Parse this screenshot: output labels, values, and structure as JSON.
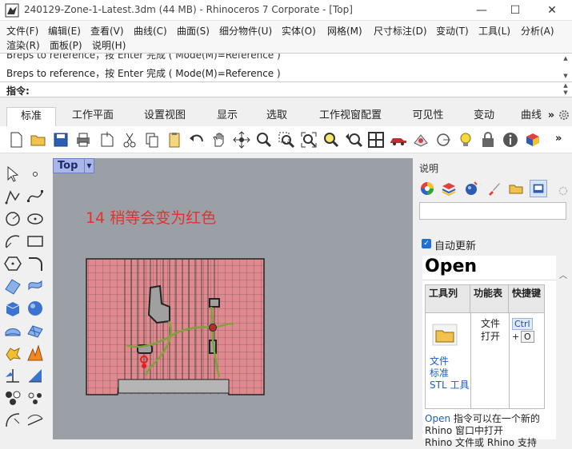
{
  "window": {
    "title": "240129-Zone-1-Latest.3dm (44 MB) - Rhinoceros 7 Corporate - [Top]",
    "minimize": "—",
    "maximize": "☐",
    "close": "✕"
  },
  "menu": {
    "row1": [
      "文件(F)",
      "编辑(E)",
      "查看(V)",
      "曲线(C)",
      "曲面(S)",
      "细分物件(U)",
      "实体(O)",
      "网格(M)",
      "尺寸标注(D)",
      "变动(T)",
      "工具(L)",
      "分析(A)"
    ],
    "row2": [
      "渲染(R)",
      "面板(P)",
      "说明(H)"
    ]
  },
  "command": {
    "history_cut": "Breps to reference，按 Enter 完成 ( Mode(M)=Reference )",
    "history_last": "Breps to reference，按 Enter 完成 ( Mode(M)=Reference )",
    "prompt_label": "指令:"
  },
  "tabs": [
    "标准",
    "工作平面",
    "设置视图",
    "显示",
    "选取",
    "工作视窗配置",
    "可见性",
    "变动",
    "曲线"
  ],
  "tabs_more": "»",
  "toolbar_more": "»",
  "viewport": {
    "name": "Top",
    "annotation": "14 稍等会变为红色"
  },
  "right_panel": {
    "title": "说明",
    "auto_update_label": "自动更新",
    "help_title": "Open",
    "table_headers": [
      "工具列",
      "功能表",
      "快捷键"
    ],
    "toolbar_cell": "文件\n标准\nSTL 工具",
    "menu_cell": "文件\n打开",
    "shortcut_keys": [
      "Ctrl",
      "+",
      "O"
    ],
    "desc_link": "Open",
    "desc_text": " 指令可以在一个新的 Rhino 窗口中打开",
    "desc_cut": "Rhino 文件或 Rhino 支持"
  },
  "colors": {
    "accent": "#1e6fd9",
    "viewport_bg": "#9aa0a6",
    "building_fill": "#e08a8f",
    "annotation": "#e53030"
  }
}
